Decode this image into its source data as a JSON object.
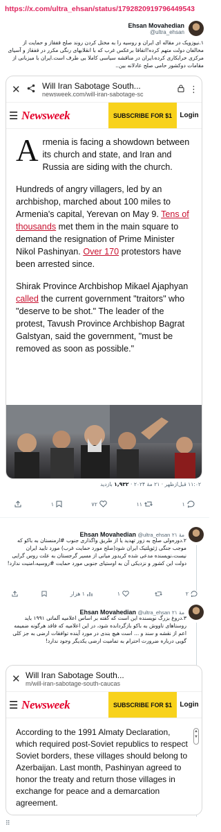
{
  "source_url": "https://x.com/ultra_ehsan/status/1792820919796449543",
  "tweet1": {
    "author_name": "Ehsan Movahedian",
    "author_handle": "@ultra_ehsan",
    "text": "۱.نیوزویک در مقاله ای ایران و روسیه را به مختل کردن روند صلح قفقاز و حمایت از مخالفان دولت متهم کرده!اتفاقا برعکس غرب که با انقلابهای رنگی مکرر در قفقاز و آسیای مرکزی خرابکاری کرده،ایران در مناقشه سیاسی کاملا بی طرف است.ایران با میزبانی از مقامات دوکشور حامی صلح عادلانه بین..",
    "card": {
      "page_title": "Will Iran Sabotage South...",
      "page_url": "newsweek.com/will-iran-sabotage-sc",
      "logo": "Newsweek",
      "subscribe_label": "SUBSCRIBE FOR $1",
      "login_label": "Login",
      "dropcap": "A",
      "p1": "rmenia is facing a showdown between its church and state, and Iran and Russia are siding with the church.",
      "p2_a": "Hundreds of angry villagers, led by an archbishop, marched about 100 miles to Armenia's capital, Yerevan on May 9. ",
      "p2_link1": "Tens of thousands",
      "p2_b": " met them in the main square to demand the resignation of Prime Minister Nikol Pashinyan. ",
      "p2_link2": "Over 170",
      "p2_c": " protestors have been arrested since.",
      "p3_a": "Shirak Province Archbishop Mikael Ajaphyan ",
      "p3_link": "called",
      "p3_b": " the current government \"traitors\" who \"deserve to be shot.\" The leader of the protest, Tavush Province Archbishop Bagrat Galstyan, said the government, \"must be removed as soon as possible.\""
    },
    "meta_time": "۱۱:۰۲ قبل‌ازظهر · ۲۱ مهٔ ۲۰۲۴ ·",
    "meta_views": "۱,۹۳۲",
    "meta_views_label": "بازدید",
    "replies": "۱",
    "retweets": "۱۱",
    "likes": "۷۲",
    "bookmarks": "۱"
  },
  "tweet2": {
    "author_name": "Ehsan Movahedian",
    "author_handle": "@ultra_ehsan",
    "time": "۲۱ مهٔ",
    "text": "۲.دوره‌ولی صلح به زور تهدید یا از طریق واگذاری جنوب #ارمنستان به باکو که موجب جنگی ژئوپلتیک ایران شود(صلح مورد حمایت غرب) مورد تایید ایران نیست،نویسنده مدعی شده کریدور میانی از مسیر گرجستان به علت روس گرایی دولت این کشور و نزدیکی آن به اوستیای جنوبی مورد حمایت #روسیه،امنیت ندارد!",
    "replies": "۲",
    "retweets": "",
    "likes": "۱",
    "views": "۱ هزار"
  },
  "tweet3": {
    "author_name": "Ehsan Movahedian",
    "author_handle": "@ultra_ehsan",
    "time": "۲۱ مهٔ",
    "text": "۳.دروغ بزرگ نویسنده این است که گفته بر اساس اعلامیه آلماتی ۱۹۹۱ باید روستاهای تاووش به باکو بازگردانده شود، در این اعلامیه که فاقد هرگونه ضمیمه اعم از نقشه و سند و ... است هیچ بندی در مورد آینده توافقات ارضی به جز کلی گویی درباره ضرورت احترام به تمامیت ارضی یکدیگر وجود ندارد!",
    "card": {
      "page_title": "Will Iran Sabotage South...",
      "page_url": "m/will-iran-sabotage-south-caucas",
      "logo": "Newsweek",
      "subscribe_label": "SUBSCRIBE FOR $1",
      "login_label": "Login",
      "text": "According to the 1991 Almaty Declaration, which required post-Soviet republics to respect Soviet borders, these villages should belong to Azerbaijan. Last month, Pashinyan agreed to honor the treaty and return those villages in exchange for peace and a demarcation agreement."
    }
  },
  "colors": {
    "url_red": "#e0245e",
    "newsweek_red": "#e4002b",
    "subscribe_yellow": "#f8d21c",
    "link_red": "#c8102e"
  }
}
